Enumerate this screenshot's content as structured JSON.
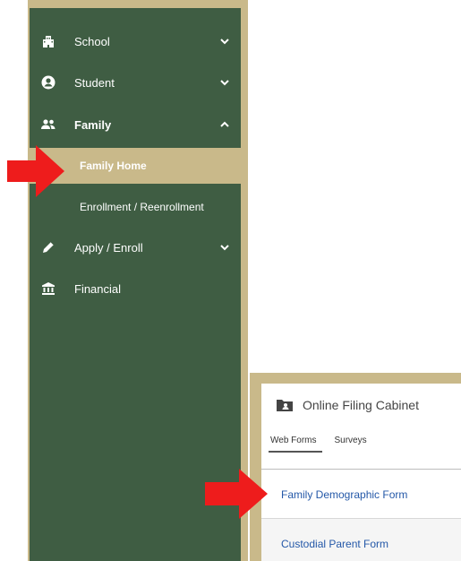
{
  "sidebar": {
    "items": [
      {
        "label": "School",
        "icon": "building-icon"
      },
      {
        "label": "Student",
        "icon": "user-circle-icon"
      },
      {
        "label": "Family",
        "icon": "people-icon"
      },
      {
        "label": "Apply / Enroll",
        "icon": "pencil-icon"
      },
      {
        "label": "Financial",
        "icon": "bank-icon"
      }
    ],
    "family_subitems": [
      {
        "label": "Family Home"
      },
      {
        "label": "Enrollment / Reenrollment"
      }
    ]
  },
  "cabinet": {
    "title": "Online Filing Cabinet",
    "tabs": [
      "Web Forms",
      "Surveys"
    ],
    "forms": [
      "Family Demographic Form",
      "Custodial Parent Form"
    ]
  },
  "colors": {
    "sidebar": "#3f5d43",
    "accent": "#c9b98a",
    "arrow": "#ee1c1c",
    "link": "#2458a8"
  }
}
